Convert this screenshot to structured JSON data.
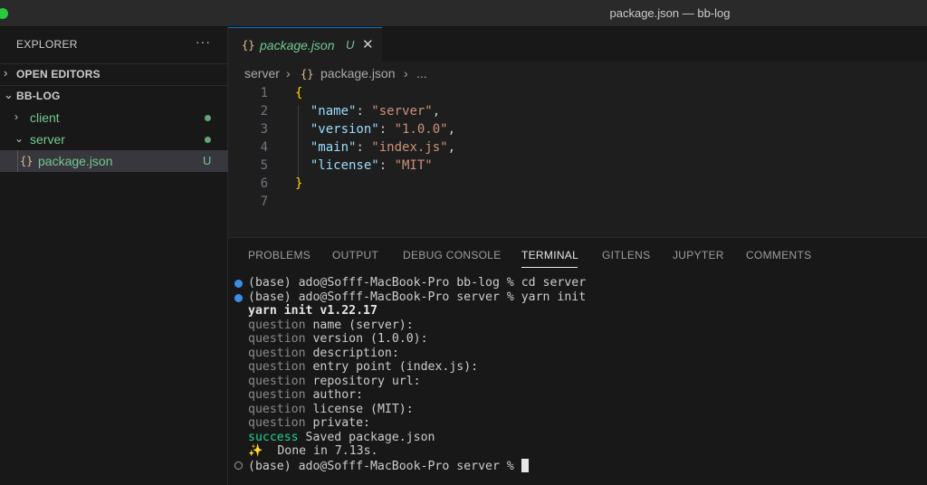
{
  "window": {
    "title": "package.json — bb-log"
  },
  "sidebar": {
    "header": "EXPLORER",
    "more": "···",
    "sections": {
      "open_editors": "OPEN EDITORS",
      "project": "BB-LOG"
    },
    "tree": {
      "client": "client",
      "server": "server",
      "file": {
        "icon": "{}",
        "name": "package.json",
        "badge": "U"
      }
    }
  },
  "tab": {
    "icon": "{}",
    "name": "package.json",
    "badge": "U",
    "close": "✕"
  },
  "breadcrumb": {
    "folder": "server",
    "sep": "›",
    "icon": "{}",
    "file": "package.json",
    "more": "..."
  },
  "editor": {
    "line_numbers": [
      "1",
      "2",
      "3",
      "4",
      "5",
      "6",
      "7"
    ],
    "open_brace": "{",
    "close_brace": "}",
    "entries": [
      {
        "key": "\"name\"",
        "value": "\"server\"",
        "trail": ","
      },
      {
        "key": "\"version\"",
        "value": "\"1.0.0\"",
        "trail": ","
      },
      {
        "key": "\"main\"",
        "value": "\"index.js\"",
        "trail": ","
      },
      {
        "key": "\"license\"",
        "value": "\"MIT\"",
        "trail": ""
      }
    ]
  },
  "panel": {
    "tabs": [
      "PROBLEMS",
      "OUTPUT",
      "DEBUG CONSOLE",
      "TERMINAL",
      "GITLENS",
      "JUPYTER",
      "COMMENTS"
    ],
    "active_tab": "TERMINAL"
  },
  "terminal": {
    "cmd1": "(base) ado@Sofff-MacBook-Pro bb-log % cd server",
    "cmd2": "(base) ado@Sofff-MacBook-Pro server % yarn init",
    "yarn_version": "yarn init v1.22.17",
    "question_label": "question",
    "questions": [
      "name (server):",
      "version (1.0.0):",
      "description:",
      "entry point (index.js):",
      "repository url:",
      "author:",
      "license (MIT):",
      "private:"
    ],
    "success_label": "success",
    "success_text": "Saved package.json",
    "done_icon": "✨",
    "done_text": "Done in 7.13s.",
    "prompt": "(base) ado@Sofff-MacBook-Pro server % "
  },
  "colors": {
    "accent": "#0078d4",
    "git_untracked": "#73c991",
    "json_key": "#9cdcfe",
    "json_string": "#ce9178",
    "brace": "#ffd700",
    "terminal_success": "#23d18b"
  }
}
